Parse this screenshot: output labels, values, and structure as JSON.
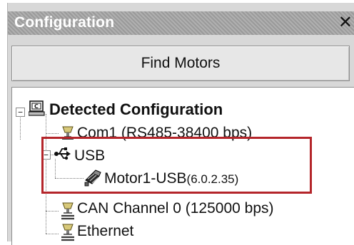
{
  "panel": {
    "title": "Configuration",
    "close_glyph": "✕",
    "find_button_label": "Find Motors"
  },
  "tree": {
    "root": {
      "label": "Detected Configuration",
      "expander": "−",
      "icon": "computer-icon"
    },
    "items": [
      {
        "label": "Com1 (RS485-38400 bps)",
        "icon": "serial-port-icon"
      },
      {
        "label": "USB",
        "expander": "−",
        "icon": "usb-icon",
        "children": [
          {
            "label": "Motor1-USB",
            "version": "(6.0.2.35)",
            "icon": "motor-icon"
          }
        ]
      },
      {
        "label": "CAN Channel 0 (125000 bps)",
        "icon": "can-port-icon"
      },
      {
        "label": "Ethernet",
        "icon": "ethernet-port-icon"
      }
    ]
  },
  "colors": {
    "highlight_border": "#b4252a",
    "titlebar": "#9a9a9a"
  }
}
